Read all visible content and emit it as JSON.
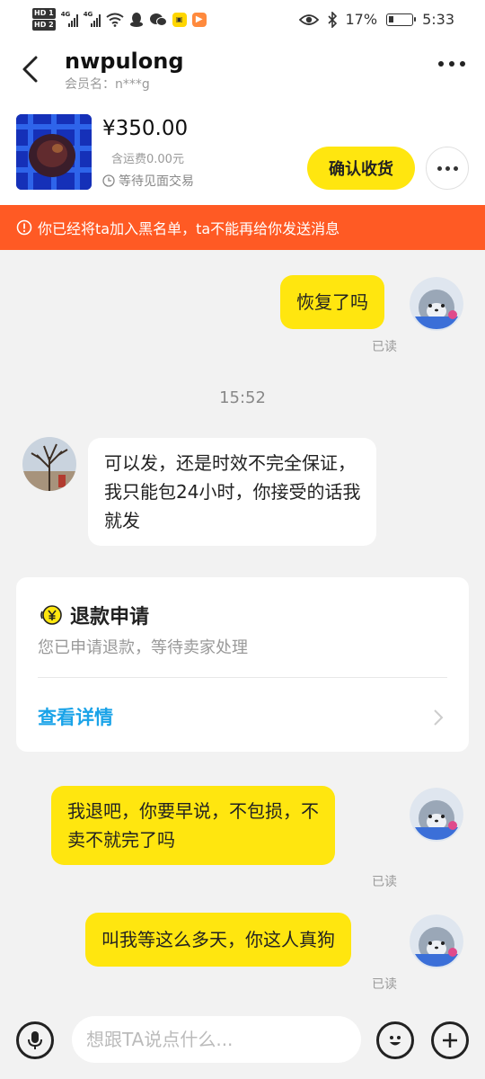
{
  "status_bar": {
    "hd_labels": [
      "HD 1",
      "HD 2"
    ],
    "network_labels": [
      "4G",
      "4G"
    ],
    "battery_percent": "17%",
    "time": "5:33"
  },
  "header": {
    "title": "nwpulong",
    "member_name": "会员名：n***g"
  },
  "product": {
    "price": "¥350.00",
    "shipping": "含运费0.00元",
    "status": "等待见面交易",
    "confirm_button": "确认收货"
  },
  "notice": {
    "blacklist_text": "你已经将ta加入黑名单，ta不能再给你发送消息",
    "color": "#ff5a24"
  },
  "messages": [
    {
      "sender": "me",
      "text": "恢复了吗",
      "read": "已读"
    },
    {
      "type": "time",
      "text": "15:52"
    },
    {
      "sender": "them",
      "lines": [
        "可以发，还是时效不完全保证，",
        "我只能包24小时，你接受的话我",
        "就发"
      ]
    },
    {
      "type": "card",
      "title": "退款申请",
      "desc": "您已申请退款，等待卖家处理",
      "link": "查看详情"
    },
    {
      "sender": "me",
      "lines": [
        "我退吧，你要早说，不包损，不",
        "卖不就完了吗"
      ],
      "read": "已读"
    },
    {
      "sender": "me",
      "text": "叫我等这么多天，你这人真狗",
      "read": "已读"
    }
  ],
  "input": {
    "placeholder": "想跟TA说点什么..."
  },
  "colors": {
    "accent_yellow": "#ffe60f",
    "link_blue": "#1aa3e8",
    "background": "#f2f2f2"
  },
  "icons": [
    "back-icon",
    "more-icon",
    "clock-icon",
    "warning-icon",
    "refund-icon",
    "chevron-right-icon",
    "microphone-icon",
    "emoji-icon",
    "plus-icon"
  ]
}
